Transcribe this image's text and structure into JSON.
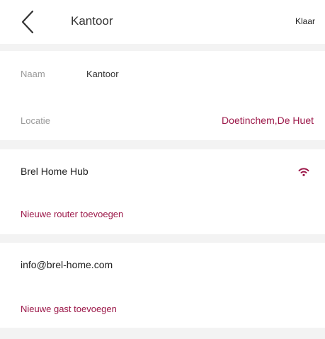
{
  "header": {
    "title": "Kantoor",
    "done_label": "Klaar"
  },
  "details": {
    "name_label": "Naam",
    "name_value": "Kantoor",
    "location_label": "Locatie",
    "location_value": "Doetinchem,De Huet"
  },
  "hub": {
    "name": "Brel Home Hub",
    "status_icon": "wifi-icon",
    "add_router_label": "Nieuwe router toevoegen"
  },
  "users": {
    "email": "info@brel-home.com",
    "add_guest_label": "Nieuwe gast toevoegen"
  },
  "colors": {
    "accent": "#9c1849",
    "background": "#f3f3f3",
    "surface": "#ffffff"
  }
}
